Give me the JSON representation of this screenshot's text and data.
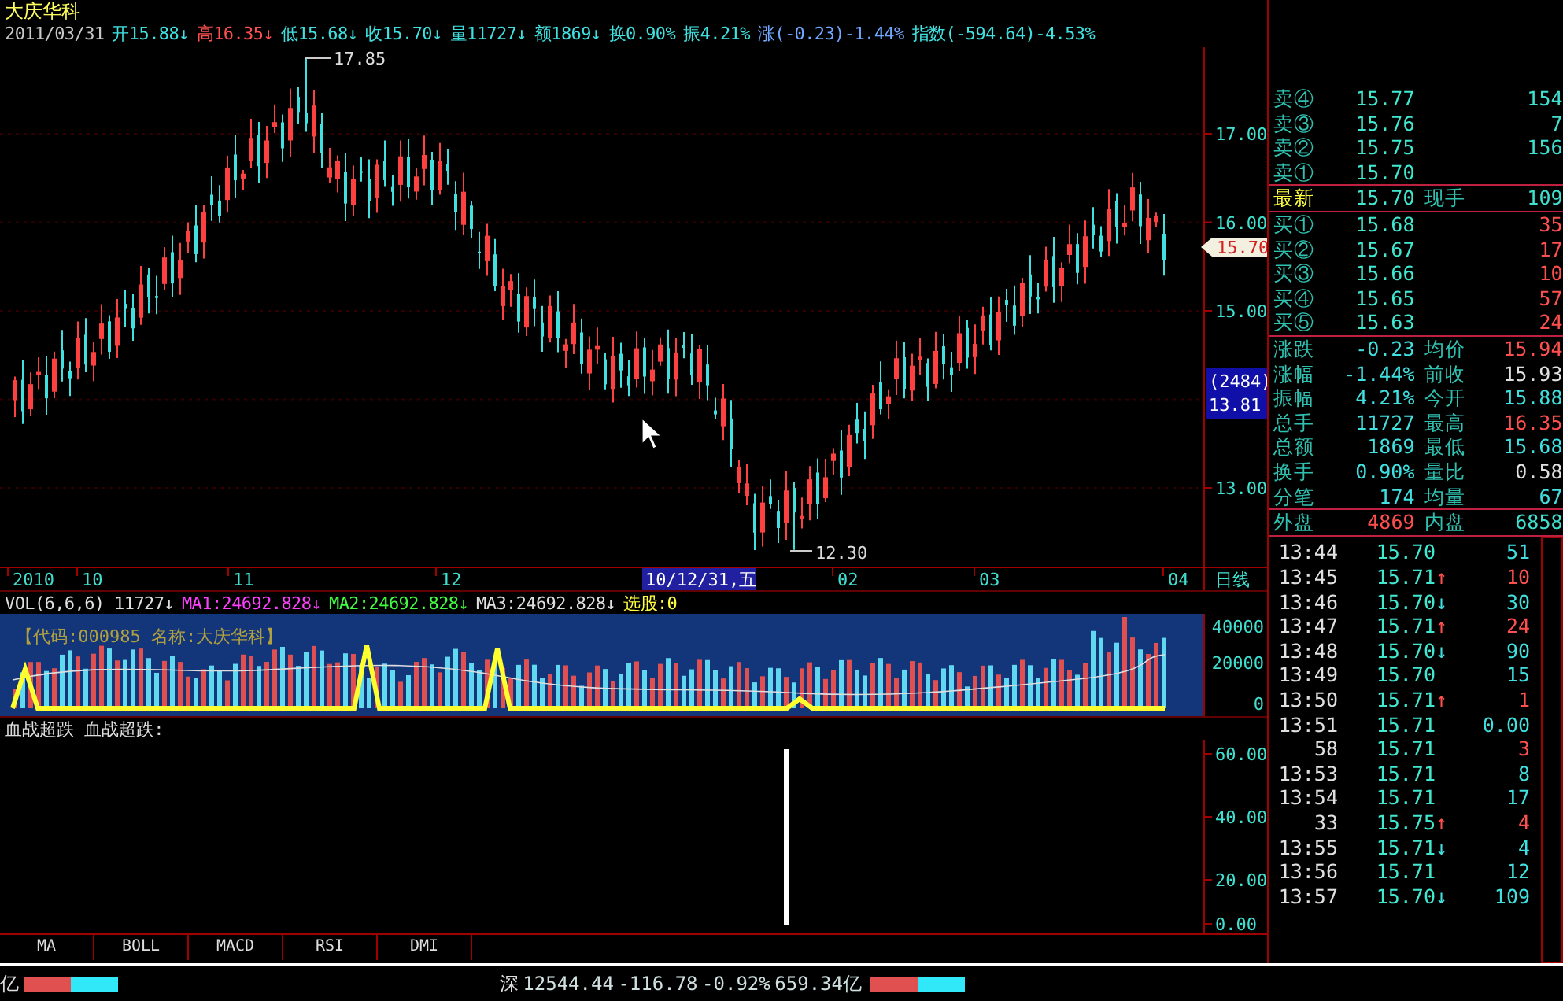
{
  "stock_name": "大庆华科",
  "quote_line": [
    {
      "text": "2011/03/31",
      "color": "#c8c8c8"
    },
    {
      "text": "开15.88↓",
      "color": "#40e0e0"
    },
    {
      "text": "高16.35↓",
      "color": "#ff5050"
    },
    {
      "text": "低15.68↓",
      "color": "#40e0e0"
    },
    {
      "text": "收15.70↓",
      "color": "#40e0e0"
    },
    {
      "text": "量11727↓",
      "color": "#40e0e0"
    },
    {
      "text": "额1869↓",
      "color": "#40e0e0"
    },
    {
      "text": "换0.90%",
      "color": "#40e0e0"
    },
    {
      "text": "振4.21%",
      "color": "#40e0e0"
    },
    {
      "text": "涨(-0.23)-1.44%",
      "color": "#6fa8ff"
    },
    {
      "text": "指数(-594.64)-4.53%",
      "color": "#40e0e0"
    }
  ],
  "price_chart": {
    "high_label": "17.85",
    "low_label": "12.30",
    "price_axis": [
      "17.00",
      "16.00",
      "15.00",
      "13.00"
    ],
    "current_price_tag": "15.70",
    "cursor_box": [
      "(2484)",
      "13.81"
    ]
  },
  "time_axis": [
    {
      "label": "2010",
      "selected": false
    },
    {
      "label": "10",
      "selected": false
    },
    {
      "label": "11",
      "selected": false
    },
    {
      "label": "12",
      "selected": false
    },
    {
      "label": "10/12/31,五",
      "selected": true
    },
    {
      "label": "02",
      "selected": false
    },
    {
      "label": "03",
      "selected": false
    },
    {
      "label": "04",
      "selected": false
    }
  ],
  "period": "日线",
  "volume_panel": {
    "legend": [
      {
        "text": "VOL(6,6,6) 11727↓",
        "color": "#e0e0e0"
      },
      {
        "text": "MA1:24692.828↓",
        "color": "#ff40ff"
      },
      {
        "text": "MA2:24692.828↓",
        "color": "#40ff40"
      },
      {
        "text": "MA3:24692.828↓",
        "color": "#e0e0e0"
      },
      {
        "text": "选股:0",
        "color": "#ffff40"
      }
    ],
    "banner": "【代码:000985 名称:大庆华科】",
    "axis": [
      "40000",
      "20000",
      "0"
    ]
  },
  "indicator_panel": {
    "legend": "血战超跌 血战超跌:",
    "axis": [
      "60.00",
      "40.00",
      "20.00",
      "0.00"
    ]
  },
  "indicator_tabs": [
    "MA",
    "BOLL",
    "MACD",
    "RSI",
    "DMI"
  ],
  "status_bar": {
    "left_text": "亿",
    "market": "深",
    "value": "12544.44",
    "change": "-116.78",
    "percent": "-0.92%",
    "turnover": "659.34亿"
  },
  "order_book": {
    "asks": [
      {
        "label": "卖④",
        "price": "15.77",
        "volume": "154"
      },
      {
        "label": "卖③",
        "price": "15.76",
        "volume": "7"
      },
      {
        "label": "卖②",
        "price": "15.75",
        "volume": "156"
      },
      {
        "label": "卖①",
        "price": "15.70"
      }
    ],
    "last": {
      "label": "最新",
      "price": "15.70",
      "label_2": "现手",
      "volume": "109"
    },
    "bids": [
      {
        "label": "买①",
        "price": "15.68",
        "volume": "35"
      },
      {
        "label": "买②",
        "price": "15.67",
        "volume": "17"
      },
      {
        "label": "买③",
        "price": "15.66",
        "volume": "10"
      },
      {
        "label": "买④",
        "price": "15.65",
        "volume": "57"
      },
      {
        "label": "买⑤",
        "price": "15.63",
        "volume": "24"
      }
    ]
  },
  "stats": [
    {
      "label": "涨跌",
      "value": "-0.23",
      "color": "#40e0e0"
    },
    {
      "label": "均价",
      "value": "15.94",
      "color": "#ff5050"
    },
    {
      "label": "涨幅",
      "value": "-1.44%",
      "color": "#40e0e0"
    },
    {
      "label": "前收",
      "value": "15.93",
      "color": "#e0e0e0"
    },
    {
      "label": "振幅",
      "value": "4.21%",
      "color": "#40e0e0"
    },
    {
      "label": "今开",
      "value": "15.88",
      "color": "#40e0e0"
    },
    {
      "label": "总手",
      "value": "11727",
      "color": "#40e0e0"
    },
    {
      "label": "最高",
      "value": "16.35",
      "color": "#ff5050"
    },
    {
      "label": "总额",
      "value": "1869",
      "color": "#40e0e0"
    },
    {
      "label": "最低",
      "value": "15.68",
      "color": "#40e0e0"
    },
    {
      "label": "换手",
      "value": "0.90%",
      "color": "#40e0e0"
    },
    {
      "label": "量比",
      "value": "0.58",
      "color": "#e0e0e0"
    },
    {
      "label": "分笔",
      "value": "174",
      "color": "#40e0e0"
    },
    {
      "label": "均量",
      "value": "67",
      "color": "#40e0e0"
    }
  ],
  "outer_inner": {
    "label": "外盘",
    "value": "4869",
    "label_2": "内盘",
    "value_2": "6858"
  },
  "ticks": [
    {
      "time": "13:44",
      "price": "15.70",
      "volume": "51",
      "color": "#40e0e0"
    },
    {
      "time": "13:45",
      "price": "15.71",
      "arrow": "↑",
      "volume": "10",
      "color": "#ff5050"
    },
    {
      "time": "13:46",
      "price": "15.70",
      "arrow": "↓",
      "volume": "30",
      "color": "#40e0e0"
    },
    {
      "time": "13:47",
      "price": "15.71",
      "arrow": "↑",
      "volume": "24",
      "color": "#ff5050"
    },
    {
      "time": "13:48",
      "price": "15.70",
      "arrow": "↓",
      "volume": "90",
      "color": "#40e0e0"
    },
    {
      "time": "13:49",
      "price": "15.70",
      "volume": "15",
      "color": "#40e0e0"
    },
    {
      "time": "13:50",
      "price": "15.71",
      "arrow": "↑",
      "volume": "1",
      "color": "#ff5050"
    },
    {
      "time": "13:51",
      "price": "15.71",
      "volume": "0.00",
      "color": "#40e0e0"
    },
    {
      "time": "58",
      "price": "15.71",
      "volume": "3",
      "color": "#ff5050"
    },
    {
      "time": "13:53",
      "price": "15.71",
      "volume": "8",
      "color": "#40e0e0"
    },
    {
      "time": "13:54",
      "price": "15.71",
      "volume": "17",
      "color": "#40e0e0"
    },
    {
      "time": "33",
      "price": "15.75",
      "arrow": "↑",
      "volume": "4",
      "color": "#ff5050"
    },
    {
      "time": "13:55",
      "price": "15.71",
      "arrow": "↓",
      "volume": "4",
      "color": "#40e0e0"
    },
    {
      "time": "13:56",
      "price": "15.71",
      "volume": "12",
      "color": "#40e0e0"
    },
    {
      "time": "13:57",
      "price": "15.70",
      "arrow": "↓",
      "volume": "109",
      "color": "#40e0e0"
    }
  ]
}
